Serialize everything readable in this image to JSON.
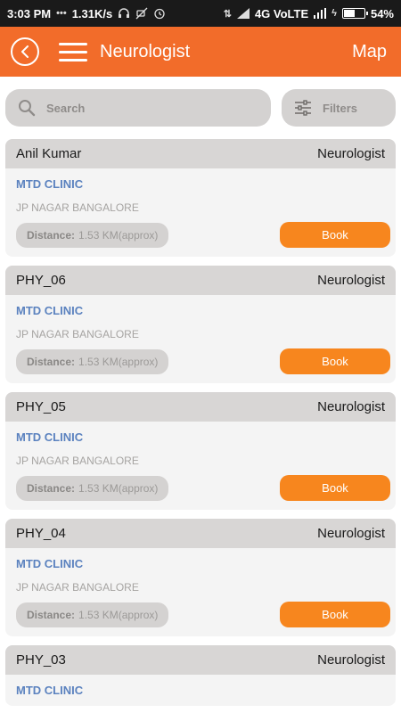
{
  "status_bar": {
    "time": "3:03 PM",
    "speed": "1.31K/s",
    "network": "4G VoLTE",
    "battery": "54%",
    "battery_level": 0.54
  },
  "app_bar": {
    "title": "Neurologist",
    "map_label": "Map"
  },
  "search": {
    "placeholder": "Search",
    "filters_label": "Filters"
  },
  "doctors": [
    {
      "name": "Anil Kumar",
      "specialty": "Neurologist",
      "clinic": "MTD CLINIC",
      "address": "JP NAGAR BANGALORE",
      "distance_label": "Distance:",
      "distance": "1.53 KM(approx)",
      "book_label": "Book"
    },
    {
      "name": "PHY_06",
      "specialty": "Neurologist",
      "clinic": "MTD CLINIC",
      "address": "JP NAGAR BANGALORE",
      "distance_label": "Distance:",
      "distance": "1.53 KM(approx)",
      "book_label": "Book"
    },
    {
      "name": "PHY_05",
      "specialty": "Neurologist",
      "clinic": "MTD CLINIC",
      "address": "JP NAGAR BANGALORE",
      "distance_label": "Distance:",
      "distance": "1.53 KM(approx)",
      "book_label": "Book"
    },
    {
      "name": "PHY_04",
      "specialty": "Neurologist",
      "clinic": "MTD CLINIC",
      "address": "JP NAGAR BANGALORE",
      "distance_label": "Distance:",
      "distance": "1.53 KM(approx)",
      "book_label": "Book"
    },
    {
      "name": "PHY_03",
      "specialty": "Neurologist",
      "clinic": "MTD CLINIC"
    }
  ],
  "colors": {
    "accent": "#f26c2a",
    "book_button": "#f7861e",
    "clinic_text": "#5b82bf"
  },
  "icons": [
    "back-arrow-icon",
    "menu-icon",
    "search-icon",
    "filters-icon",
    "wifi-icon",
    "signal-icon",
    "battery-icon"
  ]
}
